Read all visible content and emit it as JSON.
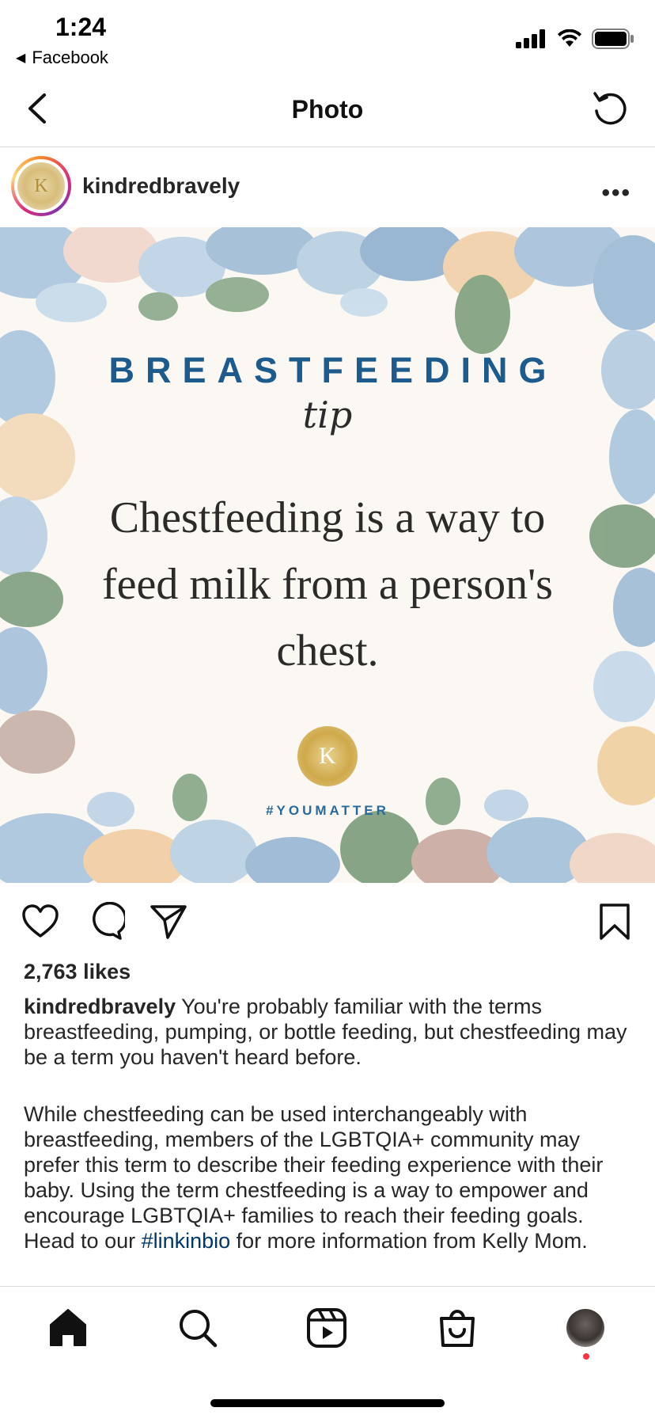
{
  "status_bar": {
    "time": "1:24",
    "back_app": "Facebook",
    "icons": [
      "signal-icon",
      "wifi-icon",
      "battery-icon"
    ]
  },
  "header": {
    "title": "Photo",
    "back_icon": "chevron-left-icon",
    "refresh_icon": "refresh-icon"
  },
  "post": {
    "username": "kindredbravely",
    "more_label": "•••",
    "image": {
      "heading": "BREASTFEEDING",
      "subheading": "tip",
      "quote": "Chestfeeding is a way to feed milk from a person's chest.",
      "seal_letter": "K",
      "tag": "#YOUMATTER"
    },
    "likes": "2,763 likes",
    "caption": {
      "username": "kindredbravely",
      "para1": "You're probably familiar with the terms breastfeeding, pumping, or bottle feeding, but chestfeeding may be a term you haven't heard before.",
      "para2_before": "While chestfeeding can be used interchangeably with breastfeeding, members of the LGBTQIA+ community may prefer this term to describe their feeding experience with their baby. Using the term chestfeeding is a way to empower and encourage LGBTQIA+ families to reach their feeding goals. Head to our ",
      "para2_hashtag": "#linkinbio",
      "para2_after": " for more information from Kelly Mom."
    }
  },
  "bottom_nav": {
    "tabs": [
      "home-icon",
      "search-icon",
      "reels-icon",
      "shop-icon",
      "profile-avatar"
    ]
  },
  "colors": {
    "accent_link": "#00376b",
    "heading_blue": "#1d5b8d",
    "notification_dot": "#ff3040"
  }
}
